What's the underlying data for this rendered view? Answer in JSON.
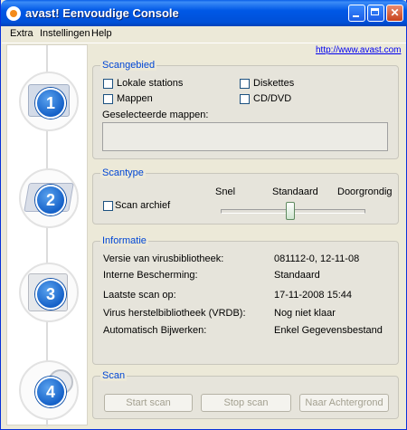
{
  "window": {
    "title": "avast! Eenvoudige Console",
    "colors": {
      "titlebar": "#0054e3",
      "accent_text": "#0046d5",
      "link": "#0000ee",
      "step_circle": "#1b6ad6"
    }
  },
  "menu": {
    "items": [
      "Extra",
      "Instellingen",
      "Help"
    ]
  },
  "link": "http://www.avast.com",
  "steps": [
    "1",
    "2",
    "3",
    "4"
  ],
  "scangebied": {
    "legend": "Scangebied",
    "options": {
      "lokale": "Lokale stations",
      "mappen": "Mappen",
      "diskettes": "Diskettes",
      "cd": "CD/DVD"
    },
    "selected_label": "Geselecteerde mappen:"
  },
  "scantype": {
    "legend": "Scantype",
    "archive": "Scan archief",
    "levels": [
      "Snel",
      "Standaard",
      "Doorgrondig"
    ],
    "selected_level": "Standaard"
  },
  "informatie": {
    "legend": "Informatie",
    "rows": [
      {
        "label": "Versie van virusbibliotheek:",
        "value": "081112-0, 12-11-08"
      },
      {
        "label": "Interne Bescherming:",
        "value": "Standaard"
      },
      {
        "label": "Laatste scan op:",
        "value": "17-11-2008 15:44"
      },
      {
        "label": "Virus herstelbibliotheek (VRDB):",
        "value": "Nog niet klaar"
      },
      {
        "label": "Automatisch Bijwerken:",
        "value": "Enkel Gegevensbestand"
      }
    ]
  },
  "scan": {
    "legend": "Scan",
    "buttons": [
      "Start scan",
      "Stop scan",
      "Naar Achtergrond"
    ]
  }
}
